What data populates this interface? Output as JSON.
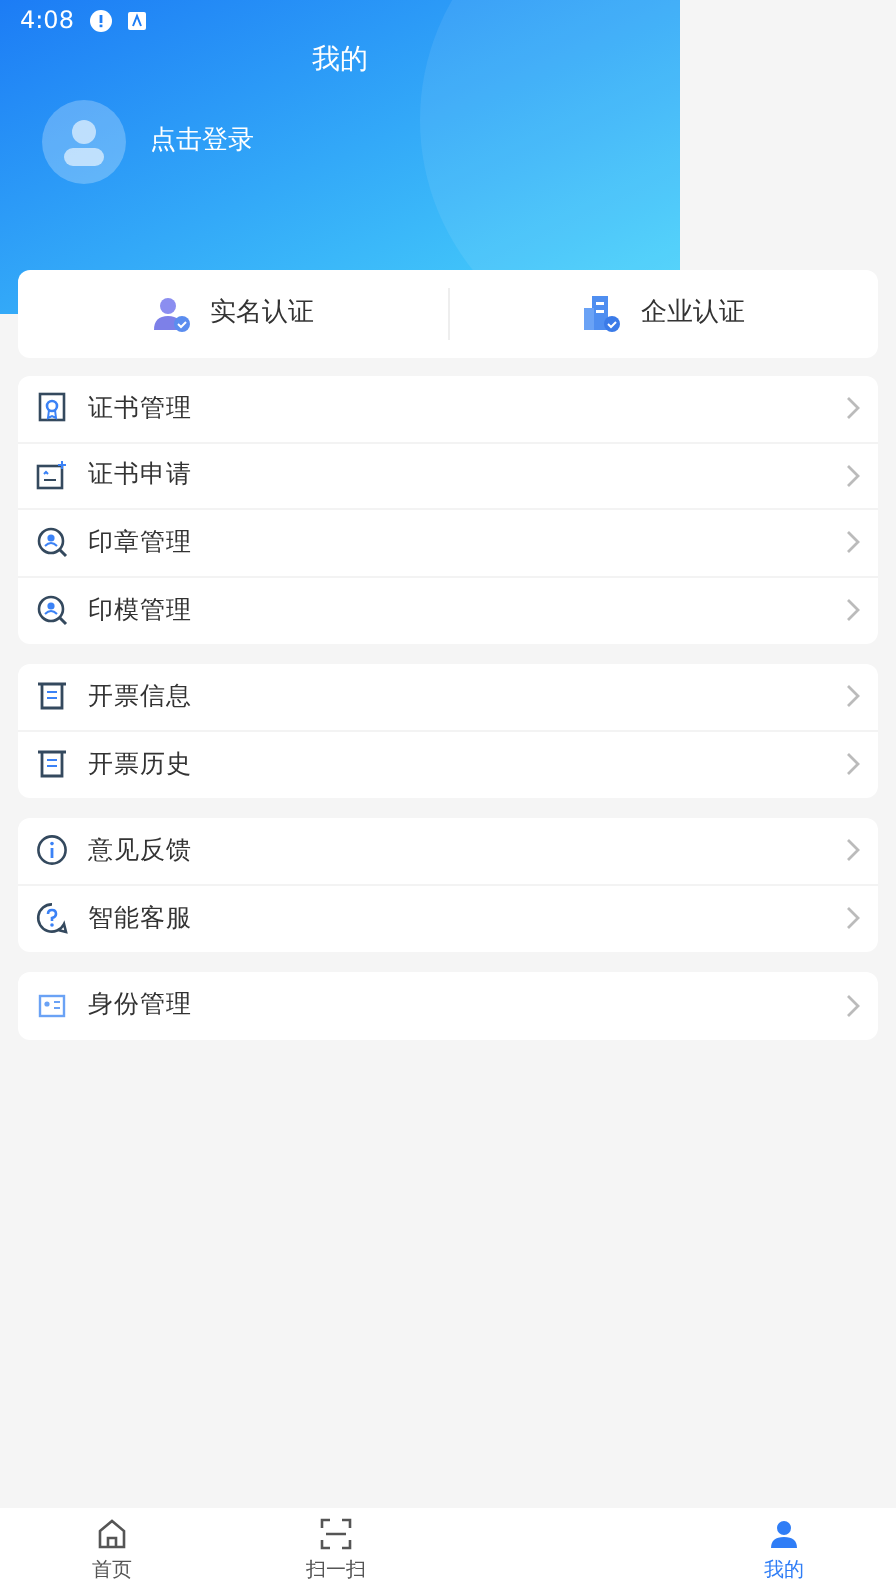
{
  "status_bar": {
    "time": "4:08"
  },
  "header": {
    "title": "我的",
    "login": "点击登录"
  },
  "auth": [
    {
      "kind": "person",
      "label": "实名认证"
    },
    {
      "kind": "company",
      "label": "企业认证"
    }
  ],
  "groups": [
    [
      {
        "kind": "cert",
        "label": "证书管理"
      },
      {
        "kind": "apply",
        "label": "证书申请"
      },
      {
        "kind": "seal",
        "label": "印章管理"
      },
      {
        "kind": "seal",
        "label": "印模管理"
      }
    ],
    [
      {
        "kind": "invoice",
        "label": "开票信息"
      },
      {
        "kind": "invoice",
        "label": "开票历史"
      }
    ],
    [
      {
        "kind": "info",
        "label": "意见反馈"
      },
      {
        "kind": "help",
        "label": "智能客服"
      }
    ],
    [
      {
        "kind": "id",
        "label": "身份管理"
      }
    ]
  ],
  "nav": [
    {
      "kind": "home",
      "label": "首页",
      "selected": false
    },
    {
      "kind": "scan",
      "label": "扫一扫",
      "selected": false
    },
    {
      "kind": "blank"
    },
    {
      "kind": "me",
      "label": "我的",
      "selected": true
    }
  ]
}
